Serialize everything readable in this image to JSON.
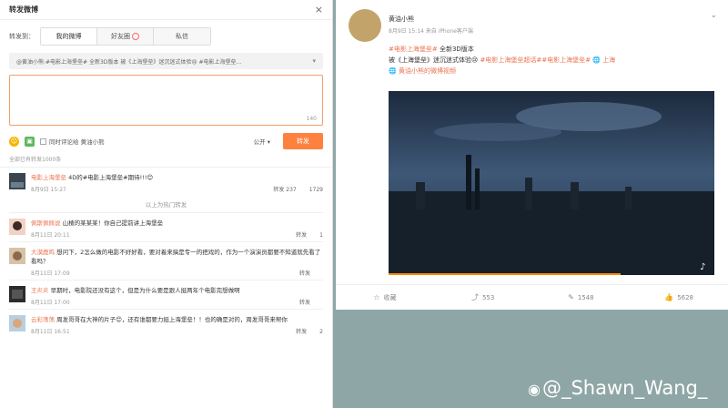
{
  "repost": {
    "title": "转发微博",
    "close": "×",
    "label": "转发到：",
    "tabs": [
      "我的微博",
      "好友圈",
      "私信"
    ],
    "quote": "@黄油小熊:#电影上海堡垒# 全新3D版本 被《上海堡垒》迷沉迷式体验😢 #电影上海堡垒...",
    "counter": "140",
    "options": {
      "emoji": "emoji-icon",
      "image": "image-icon",
      "also_comment": "同时评论给 黄油小熊"
    },
    "visibility": "公开 ▾",
    "send": "转发",
    "all_count": "全部已有转发1000条",
    "more": "以上为热门转发",
    "items": [
      {
        "name": "电影上海堡垒",
        "text": "4D的#电影上海堡垒#期待!!!😊",
        "time": "8月9日 15:27",
        "acts": [
          "转发 237",
          "1729"
        ]
      },
      {
        "name": "佩斯佩佩说",
        "text": "山楂的某某某！你自己提前讲上海堡垒",
        "time": "8月11日 20:11",
        "acts": [
          "转发",
          "1"
        ]
      },
      {
        "name": "大漠鹿鸣",
        "text": "想问下，2怎么做的电影不好好看，要对着来搞是专一的把戏的，作为一个演演员都要不知道就先看了看吗？",
        "time": "8月11日 17:09",
        "acts": [
          "转发",
          ""
        ]
      },
      {
        "name": "王炎炎",
        "text": "早期时，电影院还没有这个，但是为什么要是跟人挺两年个电影完想做啊",
        "time": "8月11日 17:00",
        "acts": [
          "转发",
          ""
        ]
      },
      {
        "name": "云彩荡荡",
        "text": "周发哥哥在大神的片子😊，还有谁都要力挺上海堡垒！！也的确是对的，周发哥哥来帮你",
        "time": "8月11日 16:51",
        "acts": [
          "转发",
          "2"
        ]
      }
    ]
  },
  "post": {
    "author": "黄油小熊",
    "sub": "8月9日 15:14 来自 iPhone客户端",
    "line1_tag": "#电影上海堡垒#",
    "line1_rest": " 全新3D版本",
    "line2": "被《上海堡垒》迷沉迷式体验😢 ",
    "line2_tags": "#电影上海堡垒超话##电影上海堡垒# 🌐 上海",
    "line3": "🌐 黄油小熊的微博视频",
    "chevron": "⌄",
    "actions": [
      {
        "icon": "☆",
        "label": "收藏"
      },
      {
        "icon": "⤴",
        "label": "553"
      },
      {
        "icon": "✎",
        "label": "1548"
      },
      {
        "icon": "👍",
        "label": "5628"
      }
    ]
  },
  "watermark": "@_Shawn_Wang_",
  "watermark_logo": "微博-logo"
}
